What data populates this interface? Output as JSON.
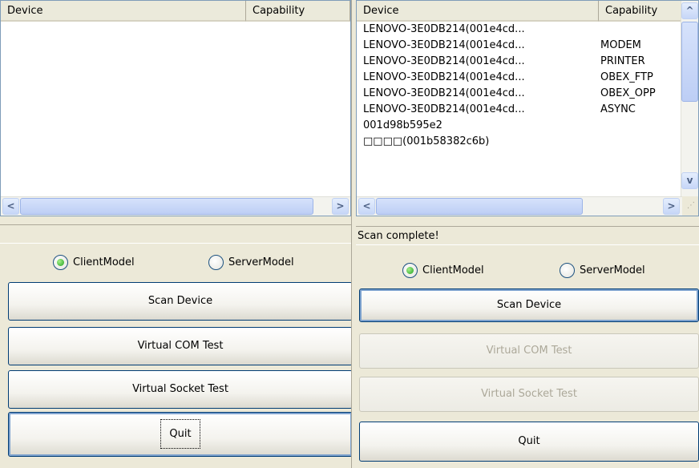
{
  "left": {
    "list": {
      "col_device": "Device",
      "col_capability": "Capability",
      "rows": []
    },
    "status": "",
    "mode": {
      "client": "ClientModel",
      "server": "ServerModel",
      "selected": "client"
    },
    "buttons": {
      "scan": "Scan Device",
      "com": "Virtual COM Test",
      "socket": "Virtual Socket Test",
      "quit": "Quit"
    }
  },
  "right": {
    "list": {
      "col_device": "Device",
      "col_capability": "Capability",
      "rows": [
        {
          "device": "LENOVO-3E0DB214(001e4cd...",
          "capability": ""
        },
        {
          "device": "LENOVO-3E0DB214(001e4cd...",
          "capability": "MODEM"
        },
        {
          "device": "LENOVO-3E0DB214(001e4cd...",
          "capability": "PRINTER"
        },
        {
          "device": "LENOVO-3E0DB214(001e4cd...",
          "capability": "OBEX_FTP"
        },
        {
          "device": "LENOVO-3E0DB214(001e4cd...",
          "capability": "OBEX_OPP"
        },
        {
          "device": "LENOVO-3E0DB214(001e4cd...",
          "capability": "ASYNC"
        },
        {
          "device": "001d98b595e2",
          "capability": ""
        },
        {
          "device": "□□□□(001b58382c6b)",
          "capability": ""
        }
      ]
    },
    "status": "Scan complete!",
    "mode": {
      "client": "ClientModel",
      "server": "ServerModel",
      "selected": "client"
    },
    "buttons": {
      "scan": "Scan Device",
      "com": "Virtual COM Test",
      "socket": "Virtual Socket Test",
      "quit": "Quit"
    }
  }
}
